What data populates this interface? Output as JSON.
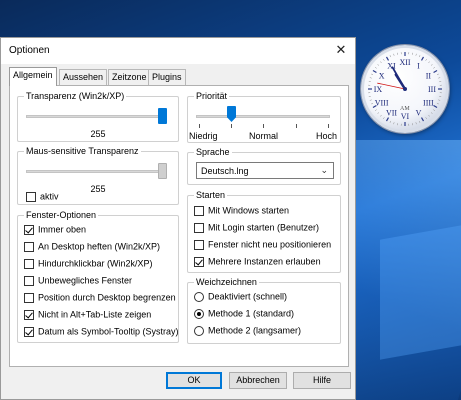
{
  "window": {
    "title": "Optionen",
    "close_glyph": "✕"
  },
  "tabs": [
    "Allgemein",
    "Aussehen",
    "Zeitzone",
    "Plugins"
  ],
  "transparency": {
    "legend": "Transparenz (Win2k/XP)",
    "value": "255",
    "level": 1.0
  },
  "mouse_transparency": {
    "legend": "Maus-sensitive Transparenz",
    "value": "255",
    "checkbox_label": "aktiv",
    "checked": false,
    "level": 1.0
  },
  "window_options": {
    "legend": "Fenster-Optionen",
    "items": [
      {
        "label": "Immer oben",
        "checked": true
      },
      {
        "label": "An Desktop heften (Win2k/XP)",
        "checked": false
      },
      {
        "label": "Hindurchklickbar (Win2k/XP)",
        "checked": false
      },
      {
        "label": "Unbewegliches Fenster",
        "checked": false
      },
      {
        "label": "Position durch Desktop begrenzen",
        "checked": false
      },
      {
        "label": "Nicht in Alt+Tab-Liste zeigen",
        "checked": true
      },
      {
        "label": "Datum als Symbol-Tooltip (Systray)",
        "checked": true
      }
    ]
  },
  "priority": {
    "legend": "Priorität",
    "low": "Niedrig",
    "normal": "Normal",
    "high": "Hoch",
    "level": 0.25
  },
  "language": {
    "legend": "Sprache",
    "selected": "Deutsch.lng"
  },
  "start": {
    "legend": "Starten",
    "items": [
      {
        "label": "Mit Windows starten",
        "checked": false
      },
      {
        "label": "Mit Login starten (Benutzer)",
        "checked": false
      },
      {
        "label": "Fenster nicht neu positionieren",
        "checked": false
      },
      {
        "label": "Mehrere Instanzen erlauben",
        "checked": true
      }
    ]
  },
  "smoothing": {
    "legend": "Weichzeichnen",
    "items": [
      {
        "label": "Deaktiviert (schnell)",
        "selected": false
      },
      {
        "label": "Methode 1 (standard)",
        "selected": true
      },
      {
        "label": "Methode 2 (langsamer)",
        "selected": false
      }
    ]
  },
  "buttons": {
    "ok": "OK",
    "cancel": "Abbrechen",
    "help": "Hilfe"
  },
  "clock": {
    "ampm": "AM",
    "hour": 10,
    "minute": 55,
    "second": 47
  },
  "colors": {
    "accent": "#0078d7",
    "desktop": "#0d4a9a"
  }
}
